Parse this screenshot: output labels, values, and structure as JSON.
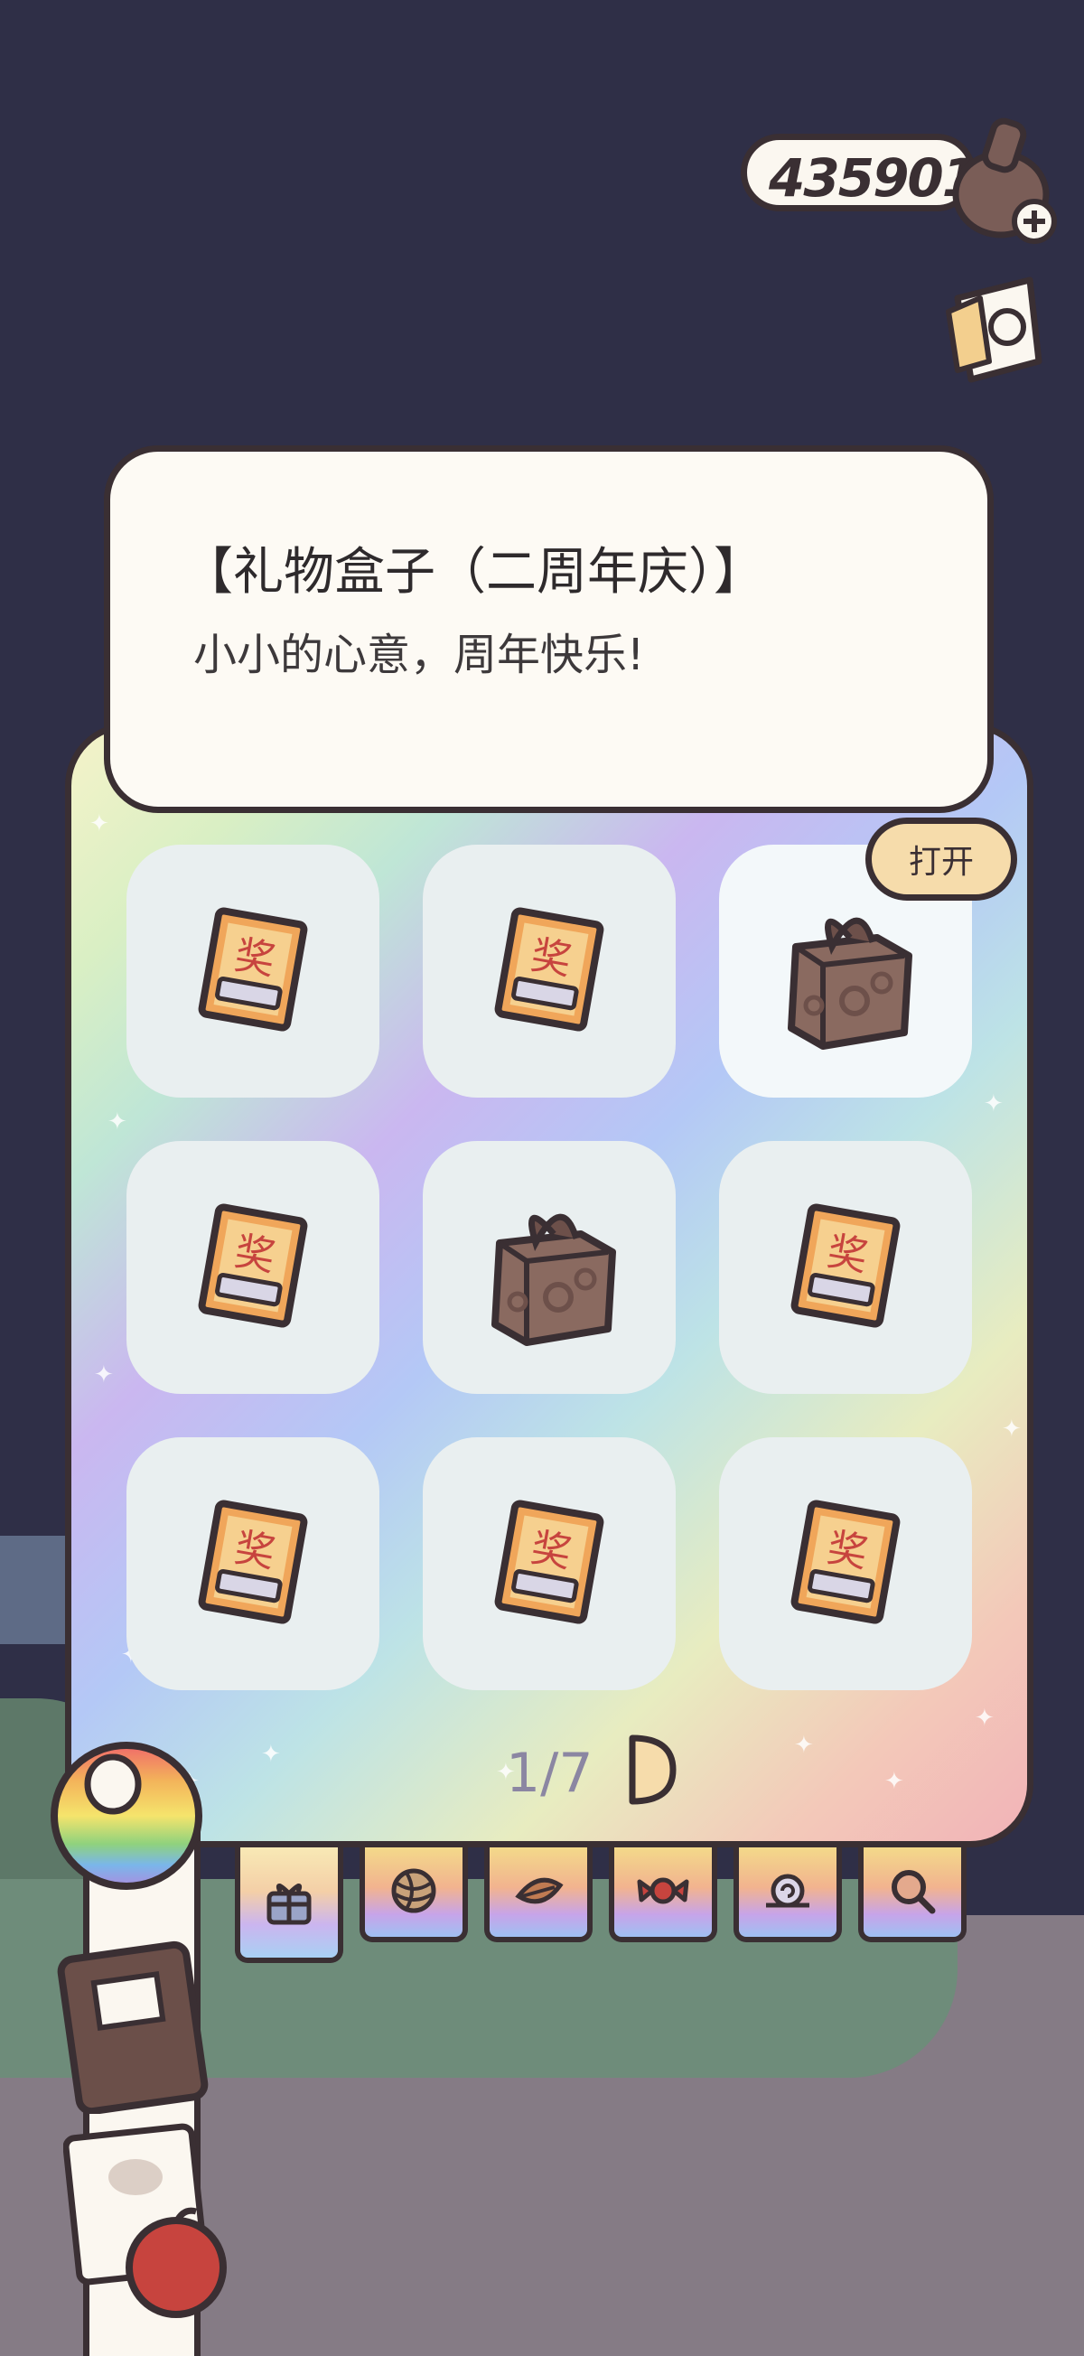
{
  "currency": {
    "value": "435901",
    "icon": "acorn-icon",
    "add_icon": "plus-icon"
  },
  "note_button": {
    "icon": "note-icon"
  },
  "item_card": {
    "title": "【礼物盒子（二周年庆）】",
    "description": "小小的心意，周年快乐!"
  },
  "open_button": {
    "label": "打开"
  },
  "grid": {
    "items": [
      {
        "icon": "prize-ticket-icon",
        "selected": false
      },
      {
        "icon": "prize-ticket-icon",
        "selected": false
      },
      {
        "icon": "gift-box-icon",
        "selected": true
      },
      {
        "icon": "prize-ticket-icon",
        "selected": false
      },
      {
        "icon": "gift-box-icon",
        "selected": false
      },
      {
        "icon": "prize-ticket-icon",
        "selected": false
      },
      {
        "icon": "prize-ticket-icon",
        "selected": false
      },
      {
        "icon": "prize-ticket-icon",
        "selected": false
      },
      {
        "icon": "prize-ticket-icon",
        "selected": false
      }
    ]
  },
  "pagination": {
    "label": "1/7",
    "current": 1,
    "total": 7,
    "next_icon": "next-arrow-icon"
  },
  "category_tabs": [
    {
      "icon": "gift-icon",
      "active": true
    },
    {
      "icon": "yarn-ball-icon",
      "active": false
    },
    {
      "icon": "leaf-icon",
      "active": false
    },
    {
      "icon": "candy-icon",
      "active": false
    },
    {
      "icon": "snail-icon",
      "active": false
    },
    {
      "icon": "magnifier-icon",
      "active": false
    }
  ],
  "colors": {
    "background": "#2f2f47",
    "outline": "#3a2f33",
    "open_button": "#f6dcab",
    "card": "#fdfaf4"
  }
}
